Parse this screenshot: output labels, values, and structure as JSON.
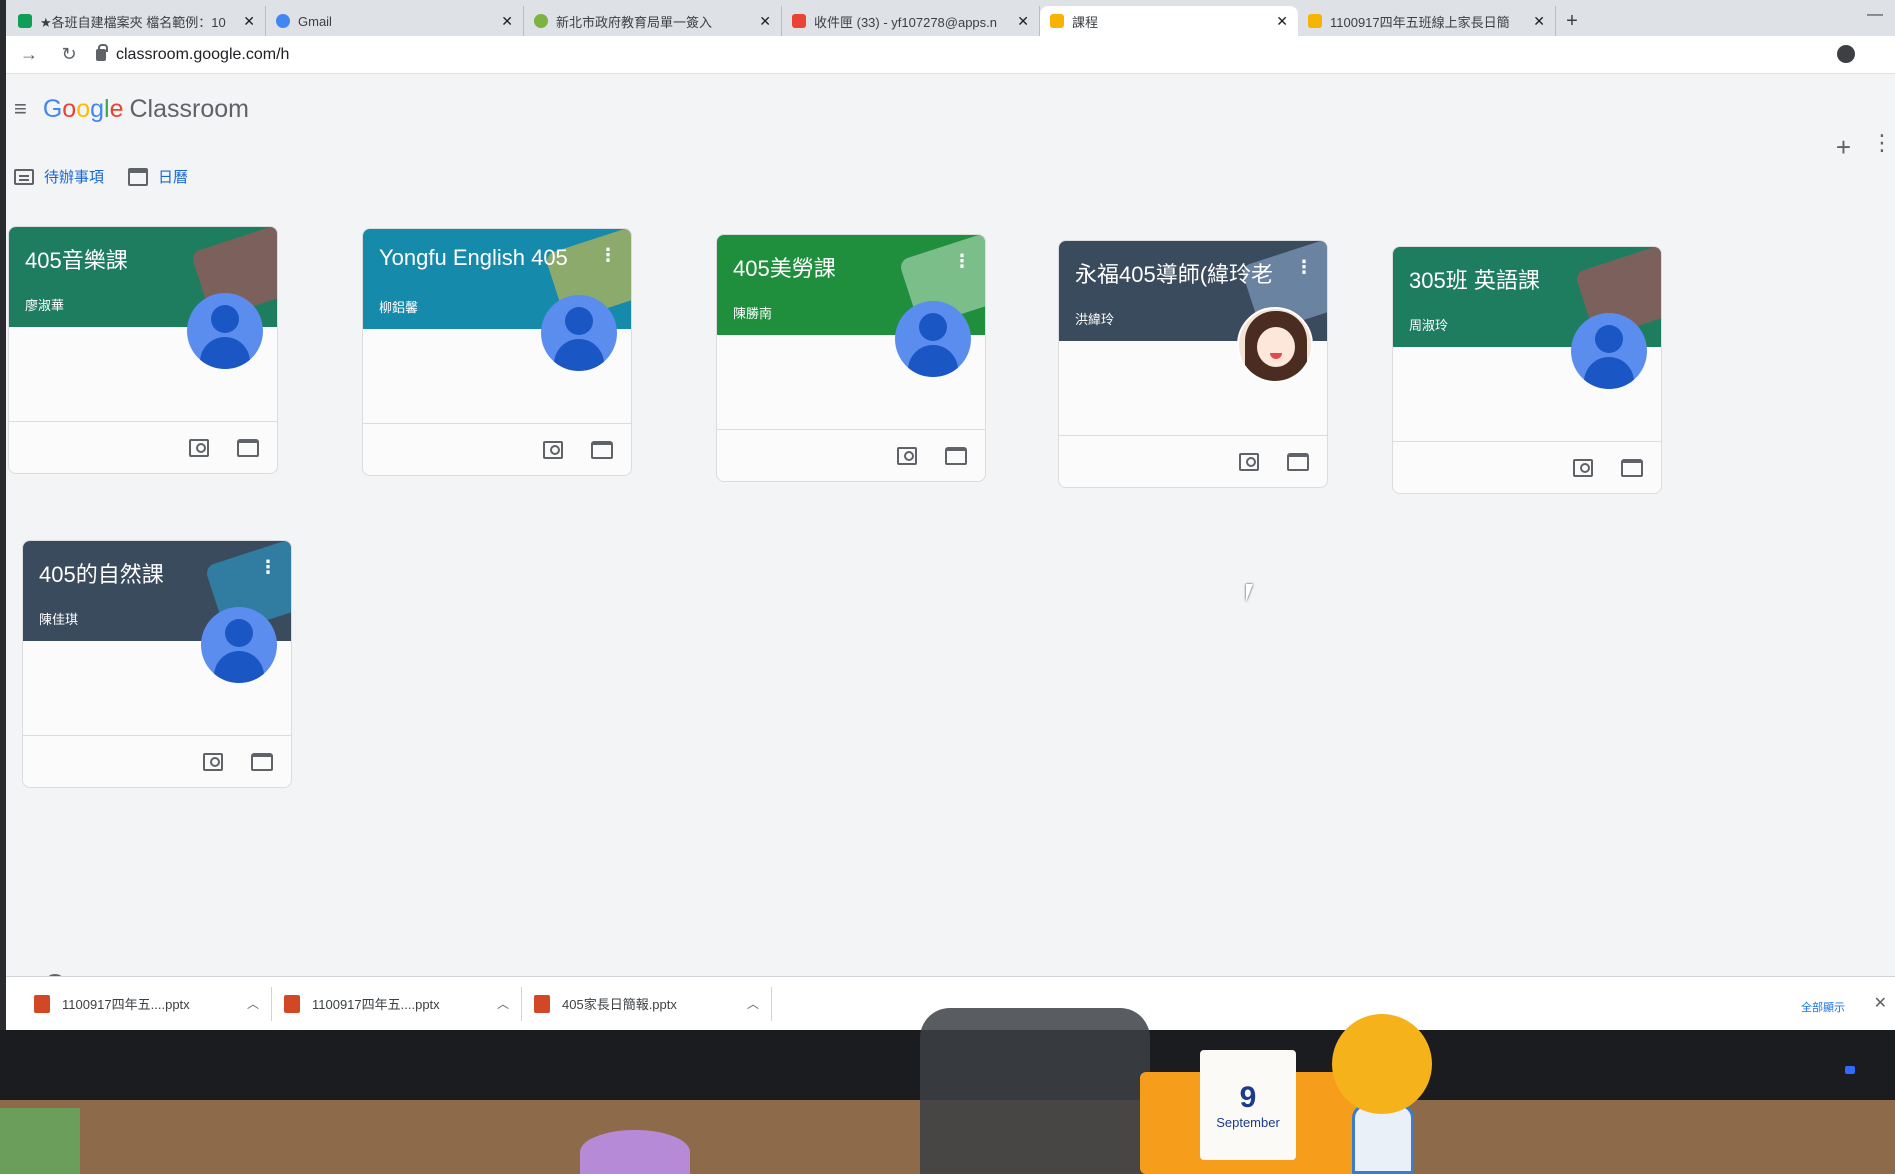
{
  "browser": {
    "tabs": [
      {
        "title": "★各班自建檔案夾 檔名範例：10",
        "icon": "sheet-icon",
        "color": "#0f9d58",
        "active": false
      },
      {
        "title": "Gmail",
        "icon": "google-g-icon",
        "color": "#4285f4",
        "active": false
      },
      {
        "title": "新北市政府教育局單一簽入",
        "icon": "ntpc-icon",
        "color": "#7cb342",
        "active": false
      },
      {
        "title": "收件匣 (33) - yf107278@apps.n",
        "icon": "gmail-icon",
        "color": "#ea4335",
        "active": false
      },
      {
        "title": "課程",
        "icon": "classroom-icon",
        "color": "#f6b400",
        "active": true
      },
      {
        "title": "1100917四年五班線上家長日簡",
        "icon": "slides-icon",
        "color": "#f4b400",
        "active": false
      }
    ],
    "url": "classroom.google.com/h"
  },
  "app": {
    "logo_google": [
      "G",
      "o",
      "o",
      "g",
      "l",
      "e"
    ],
    "logo_product": "Classroom",
    "nav": {
      "todo": "待辦事項",
      "calendar": "日曆"
    }
  },
  "classes": [
    {
      "title": "405音樂課",
      "teacher": "廖淑華",
      "color": "#1e7d5e",
      "avatar": "default",
      "more": false
    },
    {
      "title": "Yongfu English 405",
      "teacher": "柳鋁馨",
      "color": "#168aab",
      "avatar": "default",
      "more": true
    },
    {
      "title": "405美勞課",
      "teacher": "陳勝南",
      "color": "#1f8e3d",
      "avatar": "default",
      "more": true
    },
    {
      "title": "永福405導師(緯玲老",
      "teacher": "洪緯玲",
      "color": "#3b4b5e",
      "avatar": "photo",
      "more": true
    },
    {
      "title": "305班 英語課",
      "teacher": "周淑玲",
      "color": "#1e7d5e",
      "avatar": "default",
      "more": false
    },
    {
      "title": "405的自然課",
      "teacher": "陳佳琪",
      "color": "#3b4b5e",
      "avatar": "default",
      "more": true
    }
  ],
  "downloads": [
    {
      "name": "1100917四年五....pptx"
    },
    {
      "name": "1100917四年五....pptx"
    },
    {
      "name": "405家長日簡報.pptx"
    }
  ],
  "downloads_show_all": "全部顯示",
  "desk": {
    "calendar_day": "9",
    "calendar_month": "September"
  }
}
